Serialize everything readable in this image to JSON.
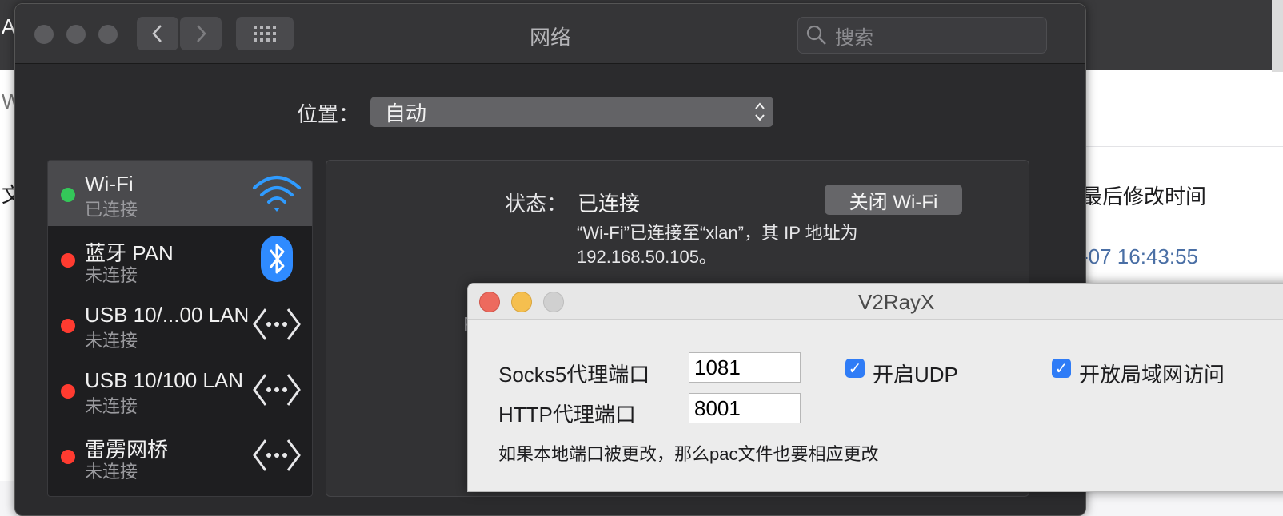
{
  "background_app": {
    "left_chars": [
      "A",
      "W",
      "文"
    ],
    "column_header": "最后修改时间",
    "column_value": "-07 16:43:55"
  },
  "network_window": {
    "title": "网络",
    "search_placeholder": "搜索",
    "location_label": "位置：",
    "location_value": "自动",
    "services": [
      {
        "name": "Wi-Fi",
        "status": "已连接",
        "dot_color": "#34c759",
        "icon": "wifi-icon",
        "selected": true
      },
      {
        "name": "蓝牙 PAN",
        "status": "未连接",
        "dot_color": "#ff3b30",
        "icon": "bluetooth-icon",
        "selected": false
      },
      {
        "name": "USB 10/...00 LAN",
        "status": "未连接",
        "dot_color": "#ff3b30",
        "icon": "ethernet-icon",
        "selected": false
      },
      {
        "name": "USB 10/100 LAN",
        "status": "未连接",
        "dot_color": "#ff3b30",
        "icon": "ethernet-icon",
        "selected": false
      },
      {
        "name": "雷雳网桥",
        "status": "未连接",
        "dot_color": "#ff3b30",
        "icon": "ethernet-icon",
        "selected": false
      }
    ],
    "status_label": "状态：",
    "status_value": "已连接",
    "wifi_off_button": "关闭 Wi-Fi",
    "status_description_line1": "“Wi-Fi”已连接至“xlan”，其 IP 地址为",
    "status_description_line2": "192.168.50.105。",
    "partial_char": "R"
  },
  "v2rayx_window": {
    "title": "V2RayX",
    "socks_label": "Socks5代理端口",
    "socks_port": "1081",
    "http_label": "HTTP代理端口",
    "http_port": "8001",
    "udp_label": "开启UDP",
    "udp_checked": true,
    "lan_label": "开放局域网访问",
    "lan_checked": true,
    "note": "如果本地端口被更改，那么pac文件也要相应更改"
  },
  "colors": {
    "accent_blue": "#2f7cf6",
    "connected_green": "#34c759",
    "disconnected_red": "#ff3b30",
    "traffic_close": "#ed6a5e",
    "traffic_min": "#f5bf4f"
  }
}
